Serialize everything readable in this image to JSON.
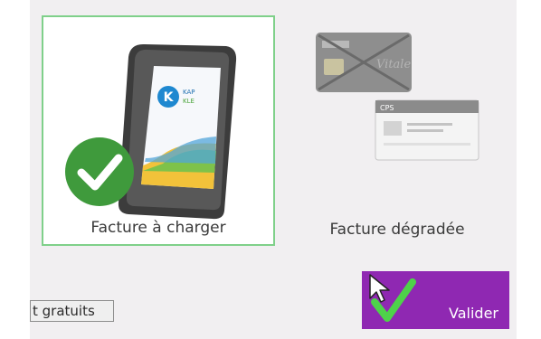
{
  "options": [
    {
      "label": "Facture à charger",
      "selected": true
    },
    {
      "label": "Facture dégradée",
      "selected": false
    }
  ],
  "terminal_logo": {
    "letter": "K",
    "text_a": "KAP",
    "text_b": "KLE"
  },
  "cards": {
    "vitale_text": "Vitale",
    "cps_text": "CPS"
  },
  "buttons": {
    "free_label": "t gratuits",
    "validate_label": "Valider"
  },
  "colors": {
    "selected_border": "#7fd08a",
    "validate_bg": "#8f28b2",
    "check_badge": "#3f9a3c",
    "check_mark_validate": "#4ed24a"
  },
  "icons": {
    "check": "check-icon",
    "cursor": "mouse-pointer-icon"
  }
}
